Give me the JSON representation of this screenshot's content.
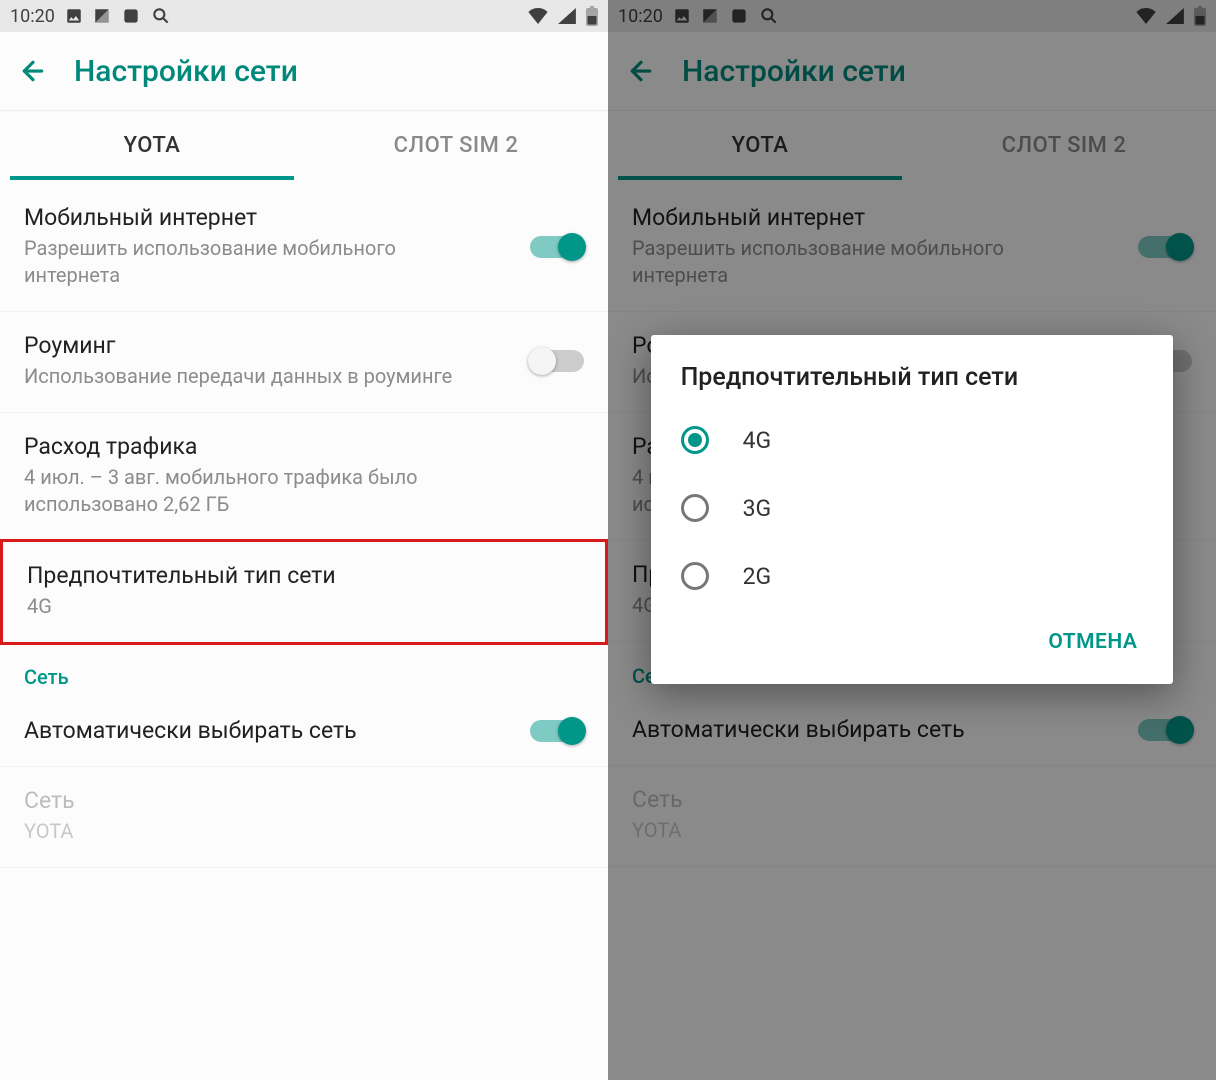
{
  "status": {
    "time": "10:20"
  },
  "appbar": {
    "title": "Настройки сети"
  },
  "tabs": {
    "active": "YOTA",
    "other": "СЛОТ SIM 2"
  },
  "items": {
    "mobile_data": {
      "title": "Мобильный интернет",
      "sub": "Разрешить использование мобильного интернета",
      "on": true
    },
    "roaming": {
      "title": "Роуминг",
      "sub": "Использование передачи данных в роуминге",
      "on": false
    },
    "usage": {
      "title": "Расход трафика",
      "sub": "4 июл. – 3 авг. мобильного трафика было использовано 2,62 ГБ"
    },
    "pref_net": {
      "title": "Предпочтительный тип сети",
      "sub": "4G"
    },
    "section": "Сеть",
    "auto_select": {
      "title": "Автоматически выбирать сеть",
      "on": true
    },
    "network_fixed": {
      "title": "Сеть",
      "sub": "YOTA"
    }
  },
  "dialog": {
    "title": "Предпочтительный тип сети",
    "options": [
      "4G",
      "3G",
      "2G"
    ],
    "selected": "4G",
    "cancel": "ОТМЕНА"
  },
  "colors": {
    "accent": "#009688"
  }
}
